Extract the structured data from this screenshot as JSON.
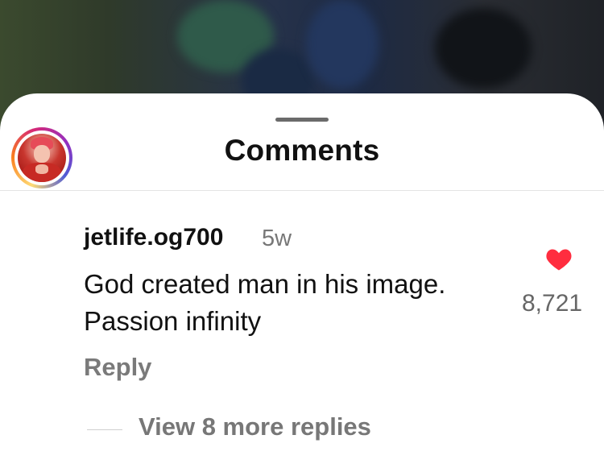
{
  "sheet": {
    "title": "Comments"
  },
  "comment": {
    "username": "jetlife.og700",
    "time_ago": "5w",
    "text_line1": "God created man in his image.",
    "text_line2": "Passion infinity",
    "reply_label": "Reply",
    "like_count": "8,721",
    "liked": true,
    "heart_color": "#ff2d3f",
    "view_replies_label": "View 8 more replies"
  },
  "icons": {
    "like": "heart-icon",
    "drag": "grabber-icon",
    "avatar": "profile-avatar"
  }
}
